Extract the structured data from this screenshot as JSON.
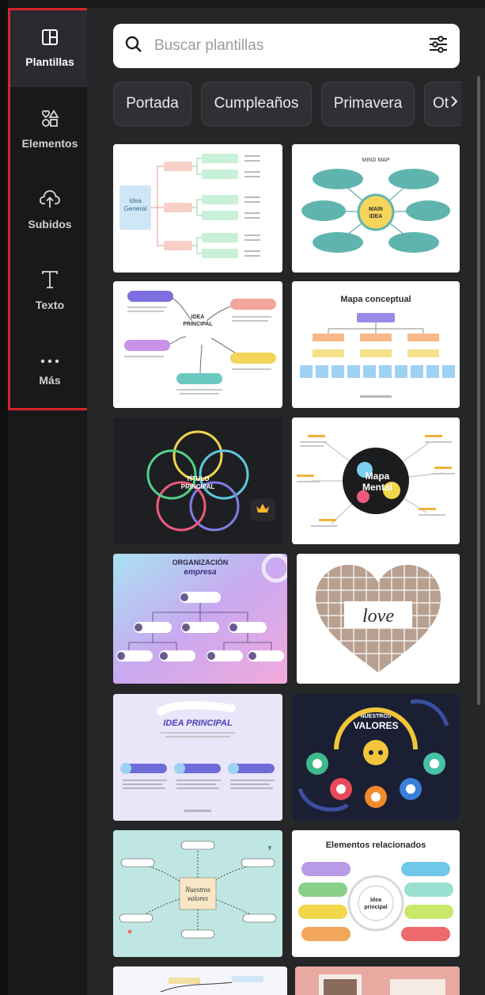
{
  "sidebar": {
    "items": [
      {
        "label": "Plantillas",
        "icon": "layout-icon",
        "active": true
      },
      {
        "label": "Elementos",
        "icon": "shapes-icon",
        "active": false
      },
      {
        "label": "Subidos",
        "icon": "cloud-upload-icon",
        "active": false
      },
      {
        "label": "Texto",
        "icon": "text-icon",
        "active": false
      },
      {
        "label": "Más",
        "icon": "more-icon",
        "active": false
      }
    ]
  },
  "search": {
    "placeholder": "Buscar plantillas",
    "icon": "search-icon",
    "filter_icon": "filter-sliders-icon"
  },
  "chips": [
    "Portada",
    "Cumpleaños",
    "Primavera",
    "Ot"
  ],
  "templates": {
    "mind_map": {
      "title": "MIND MAP",
      "center_line1": "MAIN",
      "center_line2": "IDEA"
    },
    "idea_general": {
      "center_line1": "Idea",
      "center_line2": "General"
    },
    "idea_principal_cloud": {
      "center_line1": "IDEA",
      "center_line2": "PRINCIPAL"
    },
    "mapa_conceptual": {
      "title": "Mapa conceptual"
    },
    "titulo_principal": {
      "line1": "TÍTULO",
      "line2": "PRINCIPAL"
    },
    "mapa_mental": {
      "line1": "Mapa",
      "line2": "Mental"
    },
    "organizacion": {
      "title": "ORGANIZACIÓN",
      "subtitle": "empresa"
    },
    "love": {
      "text": "love"
    },
    "idea_principal_banner": {
      "title": "IDEA PRINCIPAL"
    },
    "valores": {
      "line1": "NUESTROS",
      "line2": "VALORES"
    },
    "nuestros_valores": {
      "line1": "Nuestros",
      "line2": "valores"
    },
    "elementos_relacionados": {
      "title": "Elementos relacionados",
      "center_line1": "Idea",
      "center_line2": "principal"
    }
  },
  "colors": {
    "accent_highlight": "#d8242b",
    "panel_bg": "#252627",
    "rail_bg": "#18191b"
  }
}
